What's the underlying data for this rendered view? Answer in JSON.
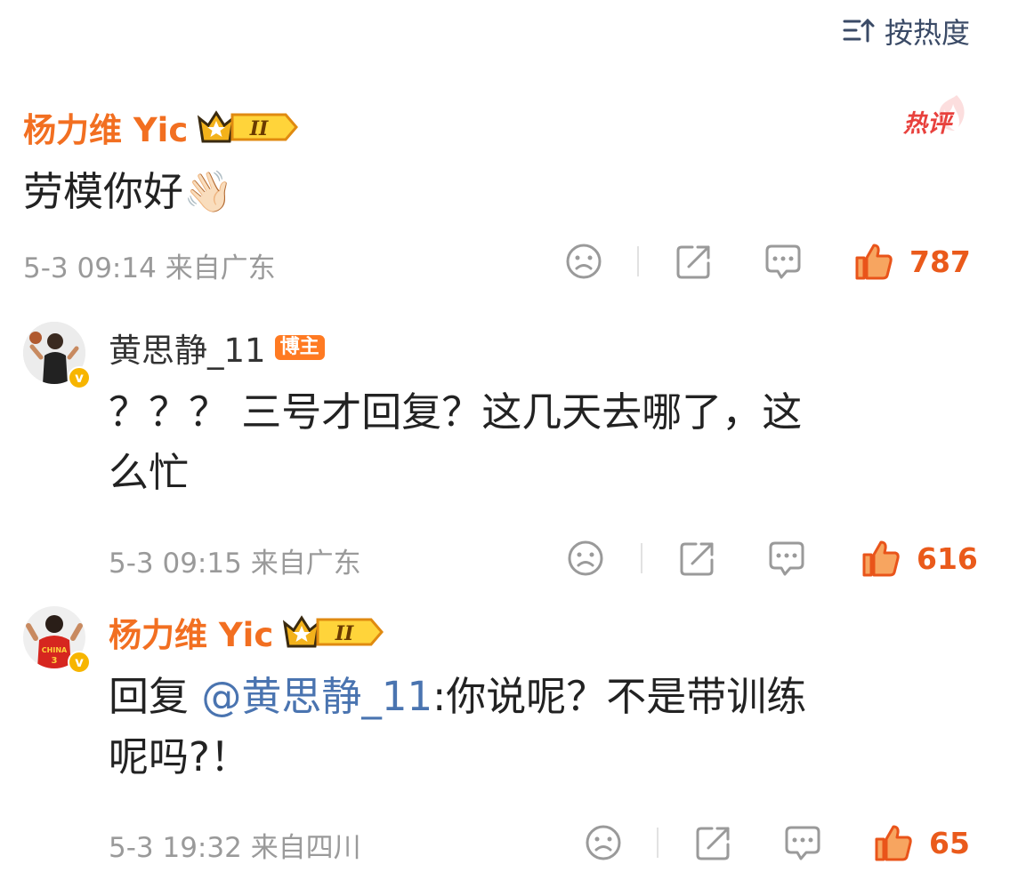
{
  "sort": {
    "label": "按热度"
  },
  "hot_tag": "热评",
  "comments": [
    {
      "author": "杨力维 Yic",
      "text": "劳模你好👋🏻",
      "time": "5-3 09:14",
      "location": "来自广东",
      "likes": "787"
    },
    {
      "author": "黄思静_11",
      "role_badge": "博主",
      "text_line1": "？？？ 三号才回复？这几天去哪了，这",
      "text_line2": "么忙",
      "time": "5-3 09:15",
      "location": "来自广东",
      "likes": "616"
    },
    {
      "author": "杨力维 Yic",
      "reply_prefix": "回复 ",
      "mention": "@黄思静_11",
      "text_line1_rest": ":你说呢？不是带训练",
      "text_line2": "呢吗?！",
      "time": "5-3 19:32",
      "location": "来自四川",
      "likes": "65"
    }
  ],
  "colors": {
    "name_orange": "#f26f21",
    "like_orange": "#ea5a1b",
    "mention_blue": "#4a74b0",
    "meta_gray": "#9a9a9a"
  }
}
